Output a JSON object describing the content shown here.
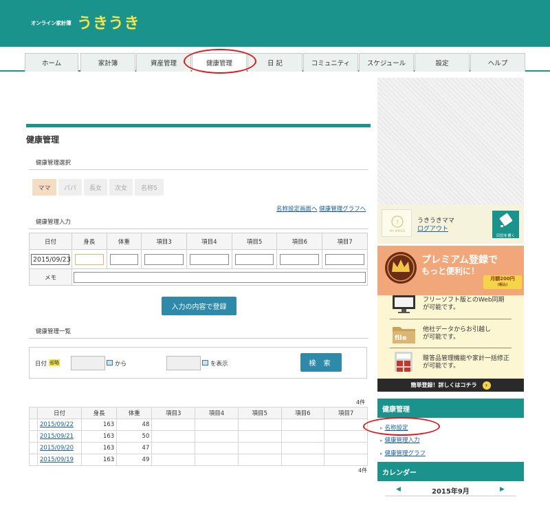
{
  "header": {
    "brand_small": "オンライン家計簿",
    "brand_big": "うきうき"
  },
  "tabs": [
    "ホーム",
    "家計簿",
    "資産管理",
    "健康管理",
    "日 記",
    "コミュニティ",
    "スケジュール",
    "設定",
    "ヘルプ"
  ],
  "main": {
    "title": "健康管理",
    "select_heading": "健康管理選択",
    "persons": [
      "ママ",
      "パパ",
      "長女",
      "次女",
      "名称5"
    ],
    "links": {
      "name_setting": "名称設定画面へ",
      "graph": "健康管理グラフへ"
    },
    "input_heading": "健康管理入力",
    "input_headers": [
      "日付",
      "身長",
      "体重",
      "項目3",
      "項目4",
      "項目5",
      "項目6",
      "項目7"
    ],
    "input_date": "2015/09/23",
    "memo_label": "メモ",
    "submit_label": "入力の内容で登録",
    "list_heading": "健康管理一覧",
    "search": {
      "date_label": "日付",
      "required": "省略",
      "from": "から",
      "show": "を表示",
      "button": "検 索"
    },
    "count_top": "4件",
    "count_bottom": "4件",
    "list_headers": [
      "日付",
      "身長",
      "体重",
      "項目3",
      "項目4",
      "項目5",
      "項目6",
      "項目7"
    ],
    "rows": [
      {
        "date": "2015/09/22",
        "height": "163",
        "weight": "48"
      },
      {
        "date": "2015/09/21",
        "height": "163",
        "weight": "50"
      },
      {
        "date": "2015/09/20",
        "height": "163",
        "weight": "47"
      },
      {
        "date": "2015/09/19",
        "height": "163",
        "weight": "49"
      }
    ]
  },
  "sidebar": {
    "avatar_text": "MY IMAGE",
    "user_name": "うきうきママ",
    "logout": "ログアウト",
    "diary_button": "日記を書く",
    "premium": {
      "title": "プレミアム登録で",
      "subtitle": "もっと便利に！",
      "price": "月額200円",
      "price_note": "(税込)",
      "features": [
        {
          "l1": "フリーソフト版とのWeb同期",
          "l2": "が可能です。"
        },
        {
          "l1": "他社データからお引越し",
          "l2": "が可能です。"
        },
        {
          "l1": "贈答品管理機能や家計一括修正",
          "l2": "が可能です。"
        }
      ],
      "file_label": "file",
      "footer": "簡単登録！詳しくはコチラ"
    },
    "health_heading": "健康管理",
    "health_links": [
      "名称設定",
      "健康管理入力",
      "健康管理グラフ"
    ],
    "calendar_heading": "カレンダー",
    "calendar_month": "2015年9月"
  },
  "colors": {
    "teal": "#1a938d",
    "brand_yellow": "#f5e44a",
    "button_blue": "#2f8aa9",
    "annotation_red": "#e0161b"
  }
}
